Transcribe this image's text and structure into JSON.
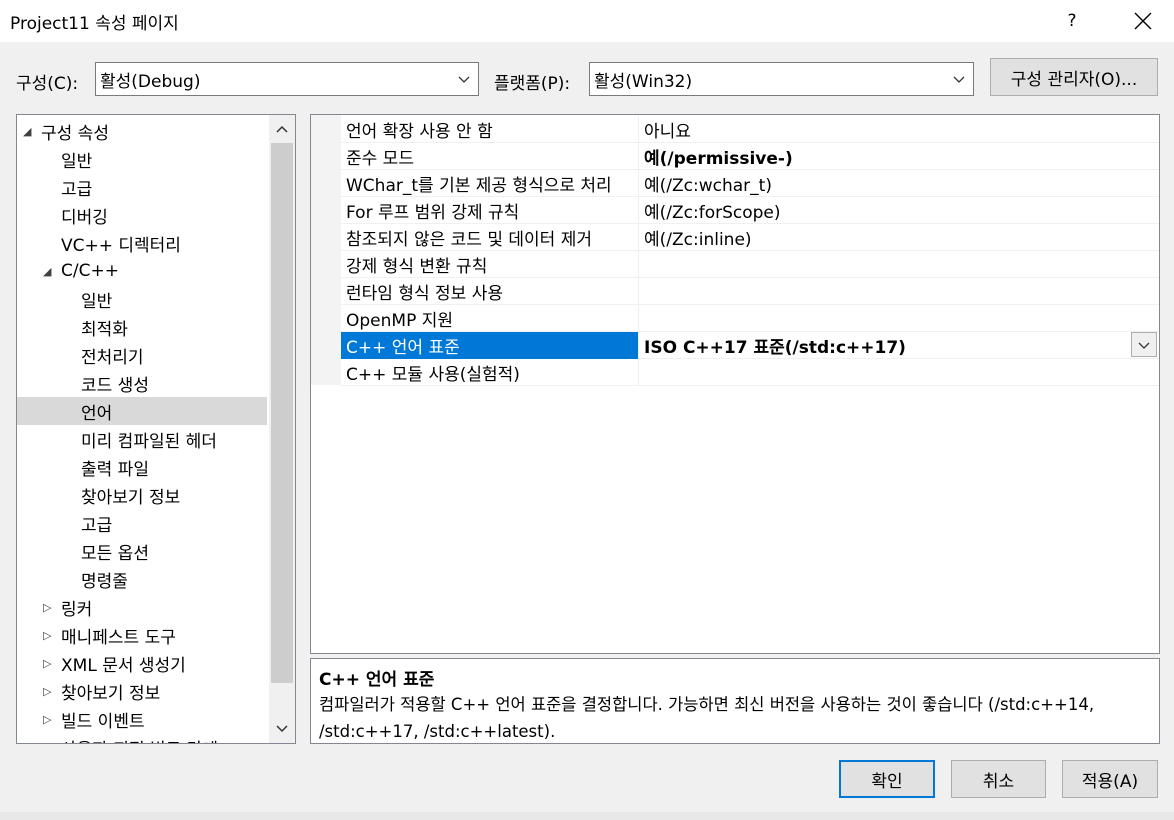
{
  "window": {
    "title": "Project11 속성 페이지",
    "help": "?"
  },
  "config": {
    "label": "구성(C):",
    "value": "활성(Debug)"
  },
  "platform": {
    "label": "플랫폼(P):",
    "value": "활성(Win32)"
  },
  "config_manager": "구성 관리자(O)...",
  "tree": [
    {
      "label": "구성 속성",
      "level": 0,
      "expander": "open"
    },
    {
      "label": "일반",
      "level": 1,
      "expander": ""
    },
    {
      "label": "고급",
      "level": 1,
      "expander": ""
    },
    {
      "label": "디버깅",
      "level": 1,
      "expander": ""
    },
    {
      "label": "VC++ 디렉터리",
      "level": 1,
      "expander": ""
    },
    {
      "label": "C/C++",
      "level": 1,
      "expander": "open"
    },
    {
      "label": "일반",
      "level": 2,
      "expander": ""
    },
    {
      "label": "최적화",
      "level": 2,
      "expander": ""
    },
    {
      "label": "전처리기",
      "level": 2,
      "expander": ""
    },
    {
      "label": "코드 생성",
      "level": 2,
      "expander": ""
    },
    {
      "label": "언어",
      "level": 2,
      "expander": "",
      "selected": true
    },
    {
      "label": "미리 컴파일된 헤더",
      "level": 2,
      "expander": ""
    },
    {
      "label": "출력 파일",
      "level": 2,
      "expander": ""
    },
    {
      "label": "찾아보기 정보",
      "level": 2,
      "expander": ""
    },
    {
      "label": "고급",
      "level": 2,
      "expander": ""
    },
    {
      "label": "모든 옵션",
      "level": 2,
      "expander": ""
    },
    {
      "label": "명령줄",
      "level": 2,
      "expander": ""
    },
    {
      "label": "링커",
      "level": 1,
      "expander": "closed"
    },
    {
      "label": "매니페스트 도구",
      "level": 1,
      "expander": "closed"
    },
    {
      "label": "XML 문서 생성기",
      "level": 1,
      "expander": "closed"
    },
    {
      "label": "찾아보기 정보",
      "level": 1,
      "expander": "closed"
    },
    {
      "label": "빌드 이벤트",
      "level": 1,
      "expander": "closed"
    },
    {
      "label": "사용자 지정 빌드 단계",
      "level": 1,
      "expander": "closed"
    }
  ],
  "properties": [
    {
      "name": "언어 확장 사용 안 함",
      "value": "아니요",
      "bold": false
    },
    {
      "name": "준수 모드",
      "value": "예(/permissive-)",
      "bold": true
    },
    {
      "name": "WChar_t를 기본 제공 형식으로 처리",
      "value": "예(/Zc:wchar_t)",
      "bold": false
    },
    {
      "name": "For 루프 범위 강제 규칙",
      "value": "예(/Zc:forScope)",
      "bold": false
    },
    {
      "name": "참조되지 않은 코드 및 데이터 제거",
      "value": "예(/Zc:inline)",
      "bold": false
    },
    {
      "name": "강제 형식 변환 규칙",
      "value": "",
      "bold": false
    },
    {
      "name": "런타임 형식 정보 사용",
      "value": "",
      "bold": false
    },
    {
      "name": "OpenMP 지원",
      "value": "",
      "bold": false
    },
    {
      "name": "C++ 언어 표준",
      "value": "ISO C++17 표준(/std:c++17)",
      "bold": true,
      "selected": true
    },
    {
      "name": "C++ 모듈 사용(실험적)",
      "value": "",
      "bold": false
    }
  ],
  "description": {
    "title": "C++ 언어 표준",
    "text": "컴파일러가 적용할 C++ 언어 표준을 결정합니다. 가능하면 최신 버전을 사용하는 것이 좋습니다 (/std:c++14, /std:c++17, /std:c++latest)."
  },
  "buttons": {
    "ok": "확인",
    "cancel": "취소",
    "apply": "적용(A)"
  },
  "colors": {
    "selection": "#0078d7",
    "tree_selection": "#d9d9d9",
    "background": "#f0f0f0"
  }
}
